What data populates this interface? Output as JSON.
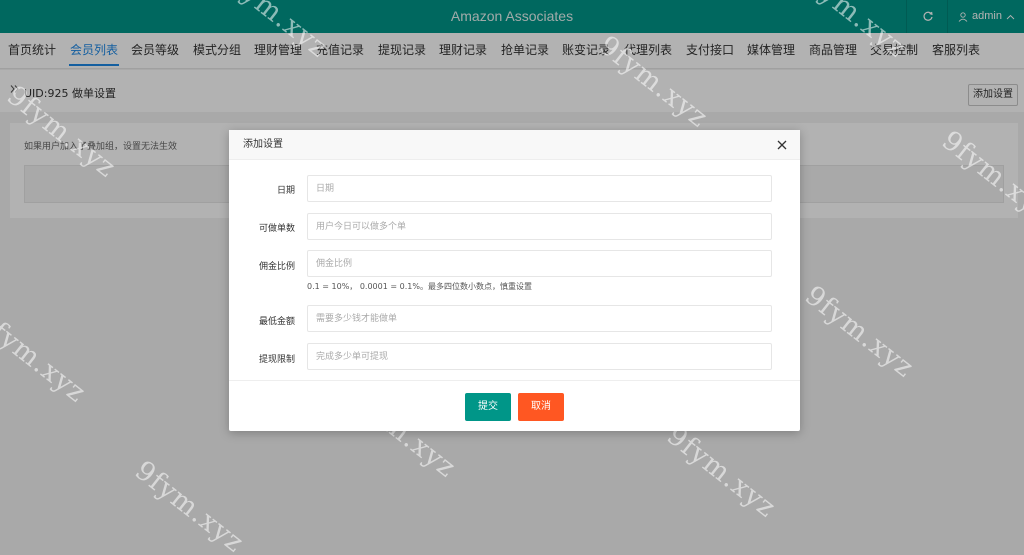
{
  "header": {
    "title": "Amazon Associates",
    "user": "admin",
    "refresh_icon": "refresh-icon",
    "user_icon": "user-icon"
  },
  "nav": {
    "items": [
      {
        "label": "首页统计"
      },
      {
        "label": "会员列表",
        "active": true
      },
      {
        "label": "会员等级"
      },
      {
        "label": "模式分组"
      },
      {
        "label": "理财管理"
      },
      {
        "label": "充值记录"
      },
      {
        "label": "提现记录"
      },
      {
        "label": "理财记录"
      },
      {
        "label": "抢单记录"
      },
      {
        "label": "账变记录"
      },
      {
        "label": "代理列表"
      },
      {
        "label": "支付接口"
      },
      {
        "label": "媒体管理"
      },
      {
        "label": "商品管理"
      },
      {
        "label": "交易控制"
      },
      {
        "label": "客服列表"
      }
    ]
  },
  "breadcrumb": {
    "text": "UID:925 做单设置",
    "add_button": "添加设置"
  },
  "page": {
    "notice": "如果用户加入了叠加组，设置无法生效"
  },
  "modal": {
    "title": "添加设置",
    "fields": [
      {
        "label": "日期",
        "placeholder": "日期"
      },
      {
        "label": "可做单数",
        "placeholder": "用户今日可以做多个单"
      },
      {
        "label": "佣金比例",
        "placeholder": "佣金比例",
        "hint": "0.1 = 10%， 0.0001 = 0.1%。最多四位数小数点，慎重设置"
      },
      {
        "label": "最低金额",
        "placeholder": "需要多少钱才能做单"
      },
      {
        "label": "提现限制",
        "placeholder": "完成多少单可提现"
      }
    ],
    "submit": "提交",
    "cancel": "取消"
  },
  "watermark": "9fym.xyz",
  "colors": {
    "primary": "#009688",
    "danger": "#ff5722",
    "active_tab": "#1e88e5"
  }
}
